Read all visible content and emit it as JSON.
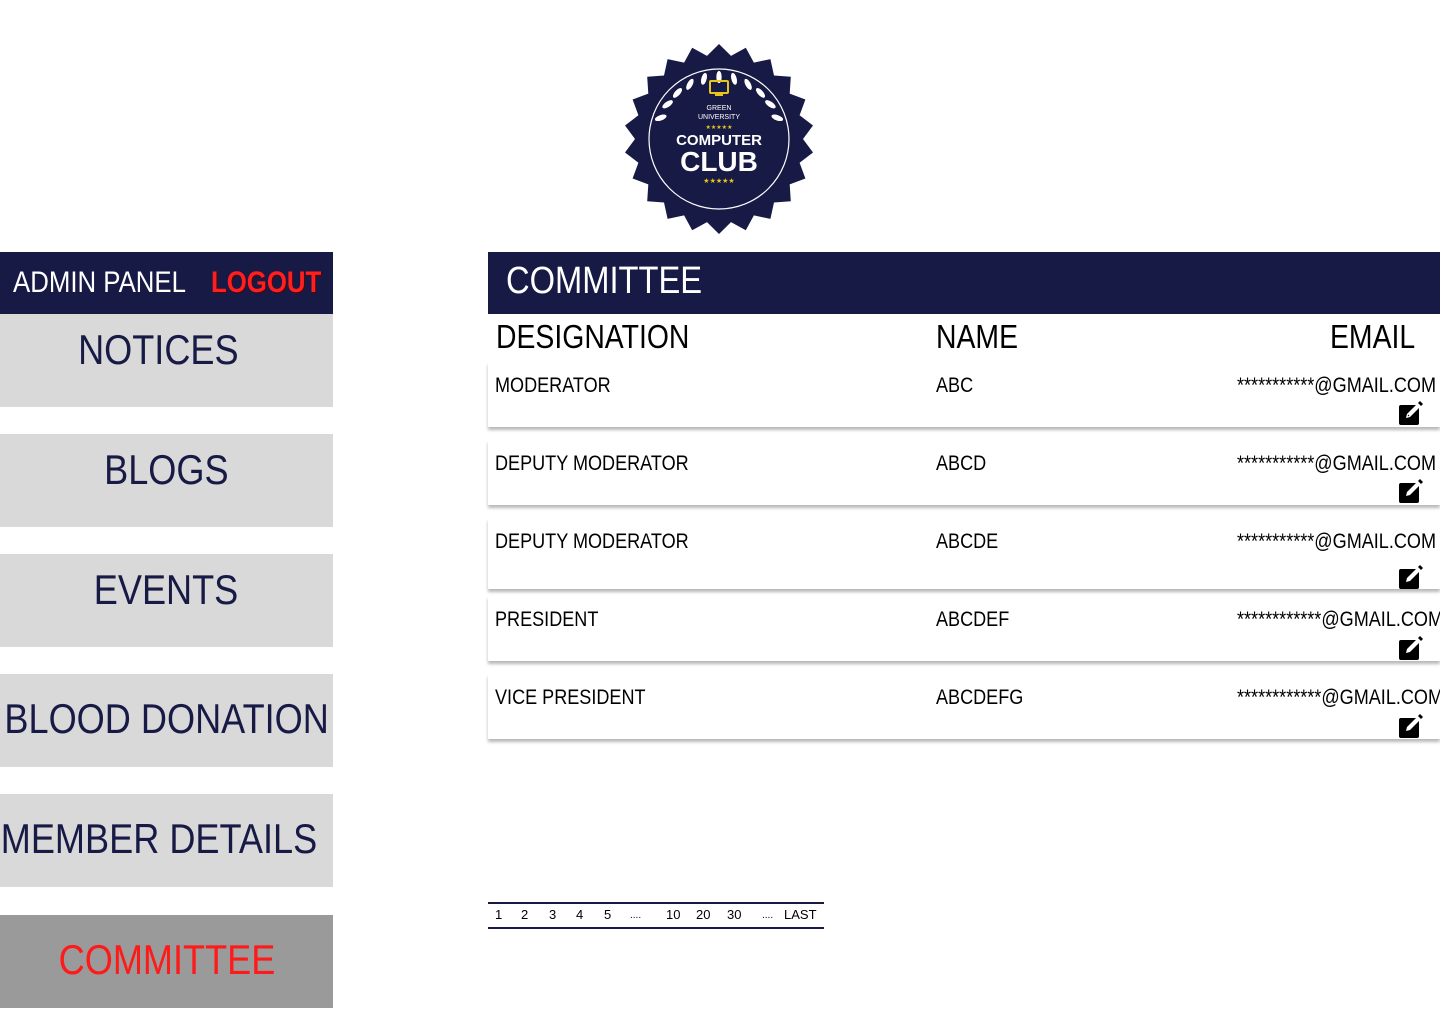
{
  "logo": {
    "line1": "GREEN",
    "line2": "UNIVERSITY",
    "line3": "COMPUTER",
    "line4": "CLUB",
    "colors": {
      "navy": "#181a46",
      "gold": "#e8c51a",
      "white": "#ffffff"
    }
  },
  "sidebar": {
    "admin_title": "ADMIN PANEL",
    "logout_label": "LOGOUT",
    "items": [
      {
        "label": "NOTICES"
      },
      {
        "label": "BLOGS"
      },
      {
        "label": "EVENTS"
      },
      {
        "label": "BLOOD DONATION"
      },
      {
        "label": "MEMBER DETAILS"
      },
      {
        "label": "COMMITTEE",
        "active": true
      }
    ]
  },
  "main": {
    "section_title": "COMMITTEE",
    "columns": {
      "designation": "DESIGNATION",
      "name": "NAME",
      "email": "EMAIL"
    },
    "rows": [
      {
        "designation": "MODERATOR",
        "name": "ABC",
        "email": "***********@GMAIL.COM",
        "action_icon": "edit-icon"
      },
      {
        "designation": "DEPUTY MODERATOR",
        "name": "ABCD",
        "email": "***********@GMAIL.COM",
        "action_icon": "edit-icon"
      },
      {
        "designation": "DEPUTY MODERATOR",
        "name": "ABCDE",
        "email": "***********@GMAIL.COM",
        "action_icon": "edit-icon"
      },
      {
        "designation": "PRESIDENT",
        "name": "ABCDEF",
        "email": "************@GMAIL.COM",
        "action_icon": "edit-icon"
      },
      {
        "designation": "VICE PRESIDENT",
        "name": "ABCDEFG",
        "email": "************@GMAIL.COM",
        "action_icon": "edit-icon"
      }
    ]
  },
  "pagination": {
    "pages": [
      "1",
      "2",
      "3",
      "4",
      "5",
      "....",
      "10",
      "20",
      "30",
      "....",
      "LAST"
    ]
  },
  "colors": {
    "navy": "#181a46",
    "danger": "#ff1f1f",
    "nav_bg": "#d9d9d9",
    "nav_active_bg": "#9a9a9a"
  }
}
